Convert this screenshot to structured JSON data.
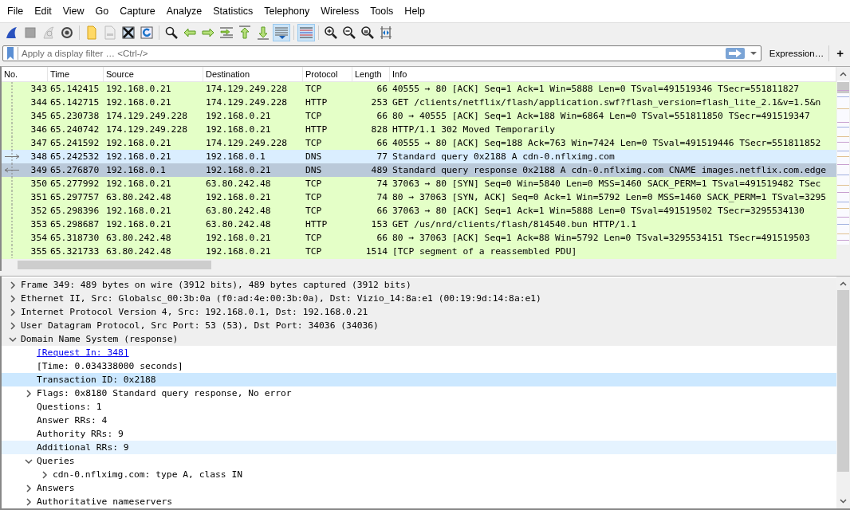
{
  "menu": [
    "File",
    "Edit",
    "View",
    "Go",
    "Capture",
    "Analyze",
    "Statistics",
    "Telephony",
    "Wireless",
    "Tools",
    "Help"
  ],
  "toolbar": [
    {
      "kind": "fin",
      "pressed": false,
      "disabled": false
    },
    {
      "kind": "stop",
      "pressed": false,
      "disabled": true
    },
    {
      "kind": "restart",
      "pressed": false,
      "disabled": true
    },
    {
      "kind": "gear",
      "pressed": false,
      "disabled": false
    },
    {
      "kind": "sep"
    },
    {
      "kind": "folder",
      "pressed": false,
      "disabled": false
    },
    {
      "kind": "file",
      "pressed": false,
      "disabled": true
    },
    {
      "kind": "close",
      "pressed": false,
      "disabled": false
    },
    {
      "kind": "reload",
      "pressed": false,
      "disabled": false
    },
    {
      "kind": "sep"
    },
    {
      "kind": "search",
      "pressed": false,
      "disabled": false
    },
    {
      "kind": "back",
      "pressed": false,
      "disabled": false
    },
    {
      "kind": "forward",
      "pressed": false,
      "disabled": false
    },
    {
      "kind": "goto",
      "pressed": false,
      "disabled": false
    },
    {
      "kind": "first",
      "pressed": false,
      "disabled": false
    },
    {
      "kind": "last",
      "pressed": false,
      "disabled": false
    },
    {
      "kind": "autoscroll",
      "pressed": true,
      "disabled": false
    },
    {
      "kind": "sep"
    },
    {
      "kind": "colorize",
      "pressed": true,
      "disabled": false
    },
    {
      "kind": "sep"
    },
    {
      "kind": "zoomin",
      "pressed": false,
      "disabled": false
    },
    {
      "kind": "zoomout",
      "pressed": false,
      "disabled": false
    },
    {
      "kind": "zoomreset",
      "pressed": false,
      "disabled": false
    },
    {
      "kind": "resize",
      "pressed": false,
      "disabled": false
    }
  ],
  "filter": {
    "placeholder": "Apply a display filter … <Ctrl-/>",
    "expression_button": "Expression…",
    "add_button": "+"
  },
  "packet_list": {
    "columns": [
      "No.",
      "Time",
      "Source",
      "Destination",
      "Protocol",
      "Length",
      "Info"
    ],
    "rows": [
      {
        "cells": [
          "343",
          "65.142415",
          "192.168.0.21",
          "174.129.249.228",
          "TCP",
          "66",
          "40555 → 80 [ACK] Seq=1 Ack=1 Win=5888 Len=0 TSval=491519346 TSecr=551811827"
        ],
        "color": "#e4ffc7",
        "selected": false,
        "kind": "plain"
      },
      {
        "cells": [
          "344",
          "65.142715",
          "192.168.0.21",
          "174.129.249.228",
          "HTTP",
          "253",
          "GET /clients/netflix/flash/application.swf?flash_version=flash_lite_2.1&v=1.5&n"
        ],
        "color": "#e4ffc7",
        "selected": false,
        "kind": "plain"
      },
      {
        "cells": [
          "345",
          "65.230738",
          "174.129.249.228",
          "192.168.0.21",
          "TCP",
          "66",
          "80 → 40555 [ACK] Seq=1 Ack=188 Win=6864 Len=0 TSval=551811850 TSecr=491519347"
        ],
        "color": "#e4ffc7",
        "selected": false,
        "kind": "plain"
      },
      {
        "cells": [
          "346",
          "65.240742",
          "174.129.249.228",
          "192.168.0.21",
          "HTTP",
          "828",
          "HTTP/1.1 302 Moved Temporarily"
        ],
        "color": "#e4ffc7",
        "selected": false,
        "kind": "plain"
      },
      {
        "cells": [
          "347",
          "65.241592",
          "192.168.0.21",
          "174.129.249.228",
          "TCP",
          "66",
          "40555 → 80 [ACK] Seq=188 Ack=763 Win=7424 Len=0 TSval=491519446 TSecr=551811852"
        ],
        "color": "#e4ffc7",
        "selected": false,
        "kind": "plain"
      },
      {
        "cells": [
          "348",
          "65.242532",
          "192.168.0.21",
          "192.168.0.1",
          "DNS",
          "77",
          "Standard query 0x2188 A cdn-0.nflximg.com"
        ],
        "color": "#daeeff",
        "selected": false,
        "kind": "request"
      },
      {
        "cells": [
          "349",
          "65.276870",
          "192.168.0.1",
          "192.168.0.21",
          "DNS",
          "489",
          "Standard query response 0x2188 A cdn-0.nflximg.com CNAME images.netflix.com.edge"
        ],
        "selected": true,
        "kind": "response"
      },
      {
        "cells": [
          "350",
          "65.277992",
          "192.168.0.21",
          "63.80.242.48",
          "TCP",
          "74",
          "37063 → 80 [SYN] Seq=0 Win=5840 Len=0 MSS=1460 SACK_PERM=1 TSval=491519482 TSec"
        ],
        "color": "#e4ffc7",
        "selected": false,
        "kind": "plain"
      },
      {
        "cells": [
          "351",
          "65.297757",
          "63.80.242.48",
          "192.168.0.21",
          "TCP",
          "74",
          "80 → 37063 [SYN, ACK] Seq=0 Ack=1 Win=5792 Len=0 MSS=1460 SACK_PERM=1 TSval=3295"
        ],
        "color": "#e4ffc7",
        "selected": false,
        "kind": "plain"
      },
      {
        "cells": [
          "352",
          "65.298396",
          "192.168.0.21",
          "63.80.242.48",
          "TCP",
          "66",
          "37063 → 80 [ACK] Seq=1 Ack=1 Win=5888 Len=0 TSval=491519502 TSecr=3295534130"
        ],
        "color": "#e4ffc7",
        "selected": false,
        "kind": "plain"
      },
      {
        "cells": [
          "353",
          "65.298687",
          "192.168.0.21",
          "63.80.242.48",
          "HTTP",
          "153",
          "GET /us/nrd/clients/flash/814540.bun HTTP/1.1"
        ],
        "color": "#e4ffc7",
        "selected": false,
        "kind": "plain"
      },
      {
        "cells": [
          "354",
          "65.318730",
          "63.80.242.48",
          "192.168.0.21",
          "TCP",
          "66",
          "80 → 37063 [ACK] Seq=1 Ack=88 Win=5792 Len=0 TSval=3295534151 TSecr=491519503"
        ],
        "color": "#e4ffc7",
        "selected": false,
        "kind": "plain"
      },
      {
        "cells": [
          "355",
          "65.321733",
          "63.80.242.48",
          "192.168.0.21",
          "TCP",
          "1514",
          "[TCP segment of a reassembled PDU]"
        ],
        "color": "#e4ffc7",
        "selected": false,
        "kind": "plain"
      }
    ]
  },
  "details": [
    {
      "text": "Frame 349: 489 bytes on wire (3912 bits), 489 bytes captured (3912 bits)",
      "kind": "field",
      "expanded": false,
      "selected": false
    },
    {
      "text": "Ethernet II, Src: Globalsc_00:3b:0a (f0:ad:4e:00:3b:0a), Dst: Vizio_14:8a:e1 (00:19:9d:14:8a:e1)",
      "kind": "field",
      "expanded": false,
      "selected": false
    },
    {
      "text": "Internet Protocol Version 4, Src: 192.168.0.1, Dst: 192.168.0.21",
      "kind": "field",
      "expanded": false,
      "selected": false
    },
    {
      "text": "User Datagram Protocol, Src Port: 53 (53), Dst Port: 34036 (34036)",
      "kind": "field",
      "expanded": false,
      "selected": false
    },
    {
      "text": "Domain Name System (response)",
      "kind": "field",
      "expanded": true,
      "selected": false,
      "children": [
        {
          "text": "[Request In: 348]",
          "kind": "link",
          "selected": false,
          "highlighted": false
        },
        {
          "text": "[Time: 0.034338000 seconds]",
          "kind": "field",
          "selected": false,
          "highlighted": false
        },
        {
          "text": "Transaction ID: 0x2188",
          "kind": "field",
          "selected": true,
          "highlighted": false
        },
        {
          "text": "Flags: 0x8180 Standard query response, No error",
          "kind": "field",
          "expanded": false,
          "selected": false,
          "highlighted": false
        },
        {
          "text": "Questions: 1",
          "kind": "field",
          "selected": false,
          "highlighted": false
        },
        {
          "text": "Answer RRs: 4",
          "kind": "field",
          "selected": false,
          "highlighted": false
        },
        {
          "text": "Authority RRs: 9",
          "kind": "field",
          "selected": false,
          "highlighted": false
        },
        {
          "text": "Additional RRs: 9",
          "kind": "field",
          "selected": false,
          "highlighted": true
        },
        {
          "text": "Queries",
          "kind": "field",
          "expanded": true,
          "selected": false,
          "highlighted": false,
          "children": [
            {
              "text": "cdn-0.nflximg.com: type A, class IN",
              "kind": "field",
              "expanded": false,
              "selected": false,
              "highlighted": false
            }
          ]
        },
        {
          "text": "Answers",
          "kind": "field",
          "expanded": false,
          "selected": false,
          "highlighted": false
        },
        {
          "text": "Authoritative nameservers",
          "kind": "field",
          "expanded": false,
          "selected": false,
          "highlighted": false
        }
      ]
    }
  ]
}
